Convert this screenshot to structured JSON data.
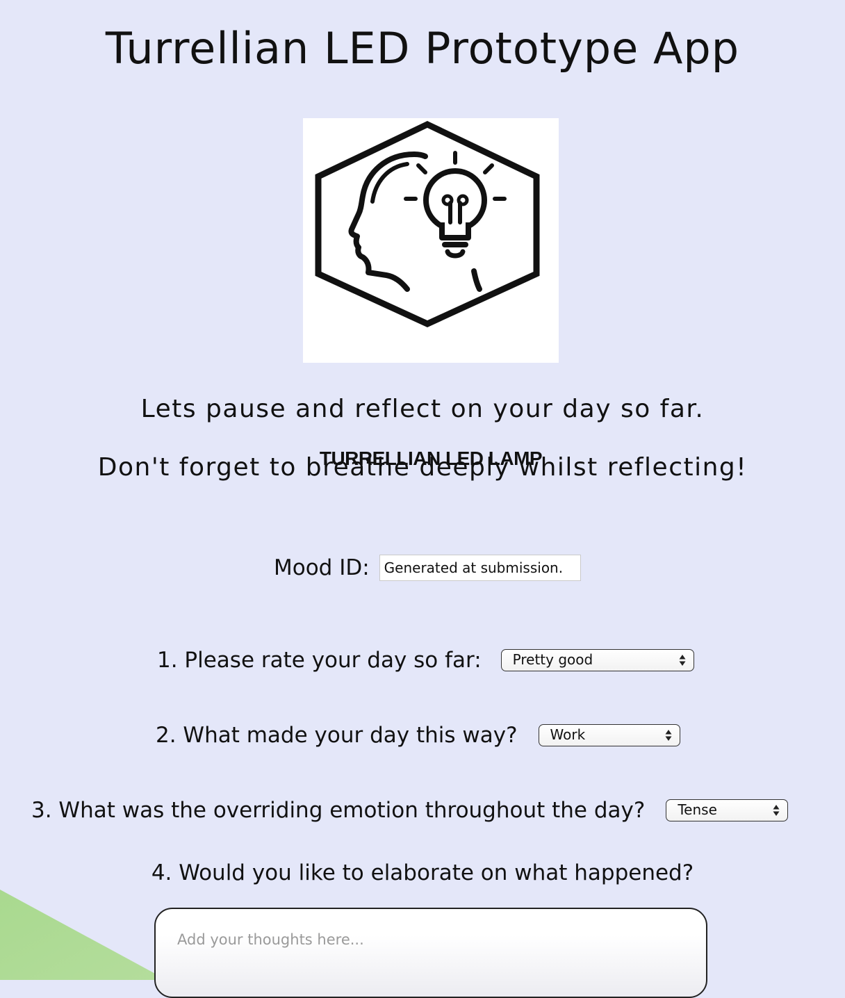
{
  "page": {
    "title": "Turrellian LED Prototype App",
    "logo_text": "TURRELLIAN LED LAMP",
    "intro_line_1": "Lets pause and reflect on your day so far.",
    "intro_line_2": "Don't forget to breathe deeply whilst reflecting!"
  },
  "form": {
    "mood_id": {
      "label": "Mood ID:",
      "value": "Generated at submission."
    },
    "q1": {
      "label": "1. Please rate your day so far:",
      "selected": "Pretty good"
    },
    "q2": {
      "label": "2. What made your day this way?",
      "selected": "Work"
    },
    "q3": {
      "label": "3. What was the overriding emotion throughout the day?",
      "selected": "Tense"
    },
    "q4": {
      "label": "4. Would you like to elaborate on what happened?",
      "placeholder": "Add your thoughts here..."
    }
  },
  "colors": {
    "background": "#e4e7f9",
    "accent_green": "#a9d98f"
  },
  "icons": {
    "logo": "head-lightbulb-hexagon-icon",
    "select": "updown-arrows-icon"
  }
}
